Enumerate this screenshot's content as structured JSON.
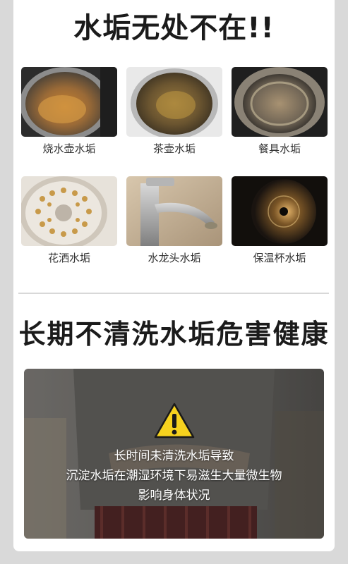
{
  "title": "水垢无处不在!!",
  "items": [
    {
      "caption": "烧水壶水垢",
      "icon": "kettle-scale-photo"
    },
    {
      "caption": "茶壶水垢",
      "icon": "teapot-scale-photo"
    },
    {
      "caption": "餐具水垢",
      "icon": "tableware-scale-photo"
    },
    {
      "caption": "花洒水垢",
      "icon": "shower-head-scale-photo"
    },
    {
      "caption": "水龙头水垢",
      "icon": "faucet-scale-photo"
    },
    {
      "caption": "保温杯水垢",
      "icon": "thermos-scale-photo"
    }
  ],
  "health": {
    "title": "长期不清洗水垢危害健康",
    "warning_icon": "warning-triangle-icon",
    "lines": [
      "长时间未清洗水垢导致",
      "沉淀水垢在潮湿环境下易滋生大量微生物",
      "影响身体状况"
    ]
  },
  "colors": {
    "background": "#d9d9d9",
    "card": "#ffffff",
    "warning_yellow": "#f6d21e",
    "heading": "#1b1b1b"
  }
}
